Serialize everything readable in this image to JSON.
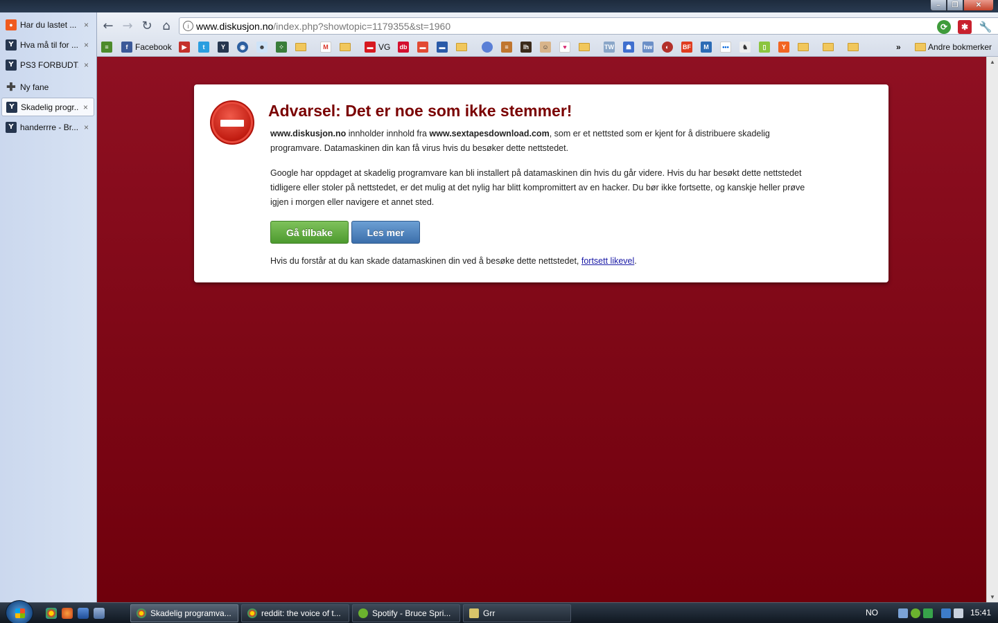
{
  "sidebar": {
    "tabs": [
      {
        "label": "Har du lastet ...",
        "icon": "orange-favicon-icon"
      },
      {
        "label": "Hva må til for ...",
        "icon": "diskusjon-favicon-icon"
      },
      {
        "label": "PS3 FORBUDT...",
        "icon": "diskusjon-favicon-icon"
      },
      {
        "label": "Ny fane",
        "icon": "plus-icon"
      },
      {
        "label": "Skadelig progr...",
        "icon": "diskusjon-favicon-icon"
      },
      {
        "label": "handerrre - Br...",
        "icon": "diskusjon-favicon-icon"
      }
    ],
    "close_glyph": "×"
  },
  "omnibox": {
    "domain": "www.diskusjon.no",
    "path": "/index.php?showtopic=1179355&st=1960"
  },
  "bookmarks": {
    "facebook": "Facebook",
    "vg": "VG",
    "other": "Andre bokmerker",
    "overflow": "»"
  },
  "warning": {
    "title": "Advarsel: Det er noe som ikke stemmer!",
    "p1_site": "www.diskusjon.no",
    "p1_mid": " innholder innhold fra ",
    "p1_bad": "www.sextapesdownload.com",
    "p1_rest": ", som er et nettsted som er kjent for å distribuere skadelig programvare. Datamaskinen din kan få virus hvis du besøker dette nettstedet.",
    "p2": "Google har oppdaget at skadelig programvare kan bli installert på datamaskinen din hvis du går videre. Hvis du har besøkt dette nettstedet tidligere eller stoler på nettstedet, er det mulig at det nylig har blitt kompromittert av en hacker. Du bør ikke fortsette, og kanskje heller prøve igjen i morgen eller navigere et annet sted.",
    "back_button": "Gå tilbake",
    "more_button": "Les mer",
    "p3_text": "Hvis du forstår at du kan skade datamaskinen din ved å besøke dette nettstedet, ",
    "p3_link": "fortsett likevel",
    "p3_end": "."
  },
  "taskbar": {
    "windows": [
      {
        "label": "Skadelig programva...",
        "active": true
      },
      {
        "label": "reddit: the voice of t...",
        "active": false
      },
      {
        "label": "Spotify - Bruce Spri...",
        "active": false
      },
      {
        "label": "Grr",
        "active": false
      }
    ],
    "language": "NO",
    "clock": "15:41"
  },
  "colors": {
    "danger_bg": "#7d0612",
    "title": "#7a0000",
    "go_back": "#5ca63a",
    "learn_more": "#4a7fbd"
  }
}
